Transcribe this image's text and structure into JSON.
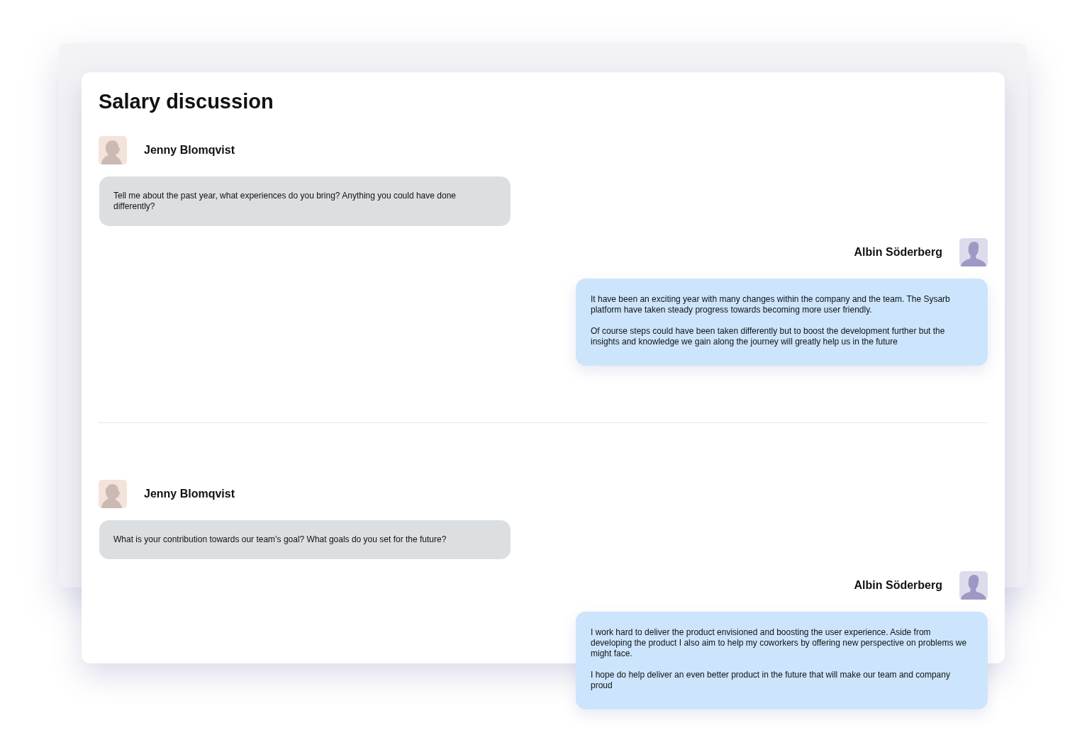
{
  "title": "Salary discussion",
  "sections": [
    {
      "messages": [
        {
          "kind": "question",
          "author": "Jenny Blomqvist",
          "paragraphs": [
            "Tell me about the past year, what experiences do you bring? Anything you could have done differently?"
          ]
        },
        {
          "kind": "answer",
          "author": "Albin Söderberg",
          "paragraphs": [
            "It have been an exciting year with many changes within the company and the team. The Sysarb platform have taken steady progress towards becoming more user friendly.",
            "Of course steps could have been taken differently but to boost the development further but the insights and knowledge we gain along the journey will greatly help us in the future"
          ]
        }
      ]
    },
    {
      "messages": [
        {
          "kind": "question",
          "author": "Jenny Blomqvist",
          "paragraphs": [
            "What is your contribution towards our team’s goal? What goals do you set for the future?"
          ]
        },
        {
          "kind": "answer",
          "author": "Albin Söderberg",
          "paragraphs": [
            "I work hard to deliver the product envisioned and boosting the user experience. Aside from developing the product I also aim to help my coworkers by offering new perspective on problems we might face.",
            "I hope do help deliver an even better product in the future that will make our team and company proud"
          ]
        }
      ]
    }
  ]
}
